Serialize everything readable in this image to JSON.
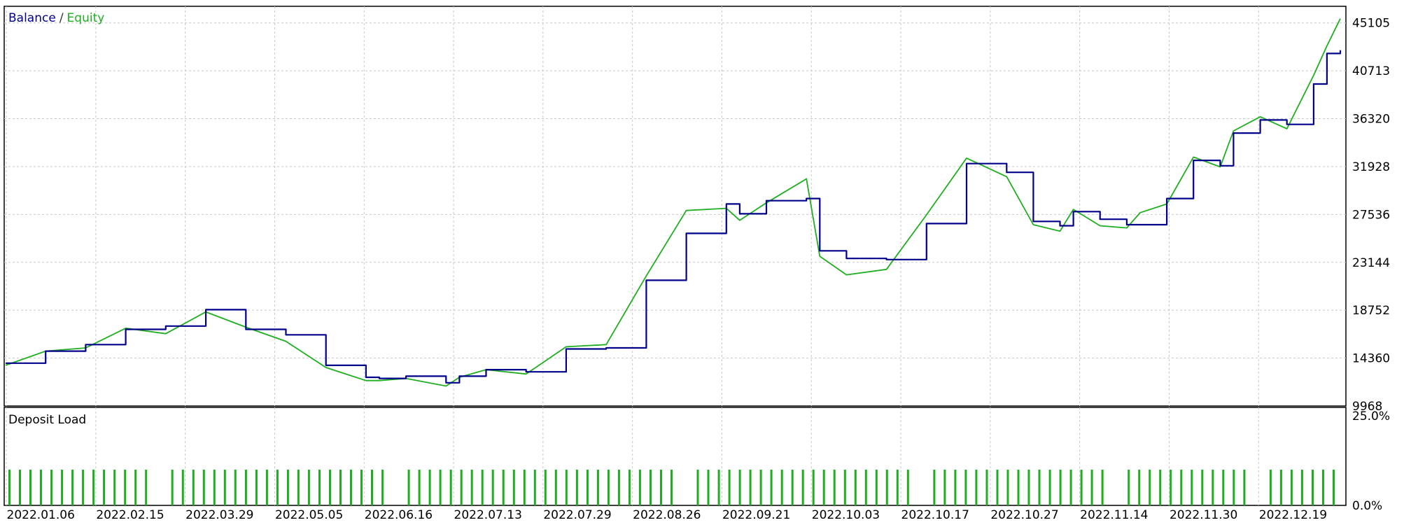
{
  "legend": {
    "balance": "Balance",
    "separator": "/",
    "equity": "Equity"
  },
  "colors": {
    "balance": "#00008b",
    "equity": "#1fae1f",
    "grid": "#c8c8c8",
    "frame": "#000000",
    "bars": "#1fae1f"
  },
  "chart_data": [
    {
      "type": "line",
      "title": "",
      "legend": [
        "Balance",
        "Equity"
      ],
      "legend_position": "top-left",
      "grid": true,
      "ylim": [
        9968,
        46500
      ],
      "y_ticks": [
        45105,
        40713,
        36320,
        31928,
        27536,
        23144,
        18752,
        14360,
        9968
      ],
      "x_ticks": [
        "2022.01.06",
        "2022.02.15",
        "2022.03.29",
        "2022.05.05",
        "2022.06.16",
        "2022.07.13",
        "2022.07.29",
        "2022.08.26",
        "2022.09.21",
        "2022.10.03",
        "2022.10.17",
        "2022.10.27",
        "2022.11.14",
        "2022.11.30",
        "2022.12.19"
      ],
      "x_index_range": [
        0,
        100
      ],
      "x_index": [
        0,
        3,
        6,
        9,
        12,
        15,
        18,
        21,
        24,
        27,
        28,
        30,
        33,
        34,
        36,
        39,
        42,
        45,
        48,
        51,
        54,
        55,
        57,
        60,
        61,
        63,
        66,
        69,
        72,
        75,
        77,
        79,
        80,
        82,
        84,
        85,
        87,
        89,
        91,
        92,
        94,
        96,
        98,
        99,
        100
      ],
      "series": [
        {
          "name": "Balance",
          "values": [
            13900,
            15000,
            15600,
            17000,
            17300,
            18800,
            17000,
            16500,
            13700,
            12600,
            12500,
            12700,
            12100,
            12700,
            13300,
            13100,
            15200,
            15300,
            21500,
            25800,
            28500,
            27600,
            28800,
            29000,
            24200,
            23500,
            23400,
            26700,
            32200,
            31400,
            26900,
            26500,
            27800,
            27100,
            26600,
            26600,
            29000,
            32500,
            32000,
            35000,
            36200,
            35800,
            39500,
            42300,
            42600
          ]
        },
        {
          "name": "Equity",
          "values": [
            13700,
            15000,
            15300,
            17100,
            16600,
            18600,
            17200,
            15900,
            13500,
            12300,
            12300,
            12500,
            11800,
            12600,
            13300,
            12900,
            15400,
            15600,
            21900,
            27900,
            28100,
            27000,
            28600,
            30800,
            23700,
            22000,
            22500,
            27500,
            32700,
            31000,
            26600,
            26000,
            28000,
            26500,
            26300,
            27700,
            28500,
            32800,
            31900,
            35200,
            36500,
            35400,
            40300,
            43000,
            45500
          ]
        }
      ]
    },
    {
      "type": "bar",
      "title": "Deposit Load",
      "ylim": [
        0,
        25
      ],
      "y_ticks_label": [
        "25.0%",
        "0.0%"
      ],
      "bar_count": 118,
      "bar_value_percent": 9.4,
      "gap_after_bars": [
        13,
        34,
        60,
        81,
        98,
        110
      ]
    }
  ]
}
